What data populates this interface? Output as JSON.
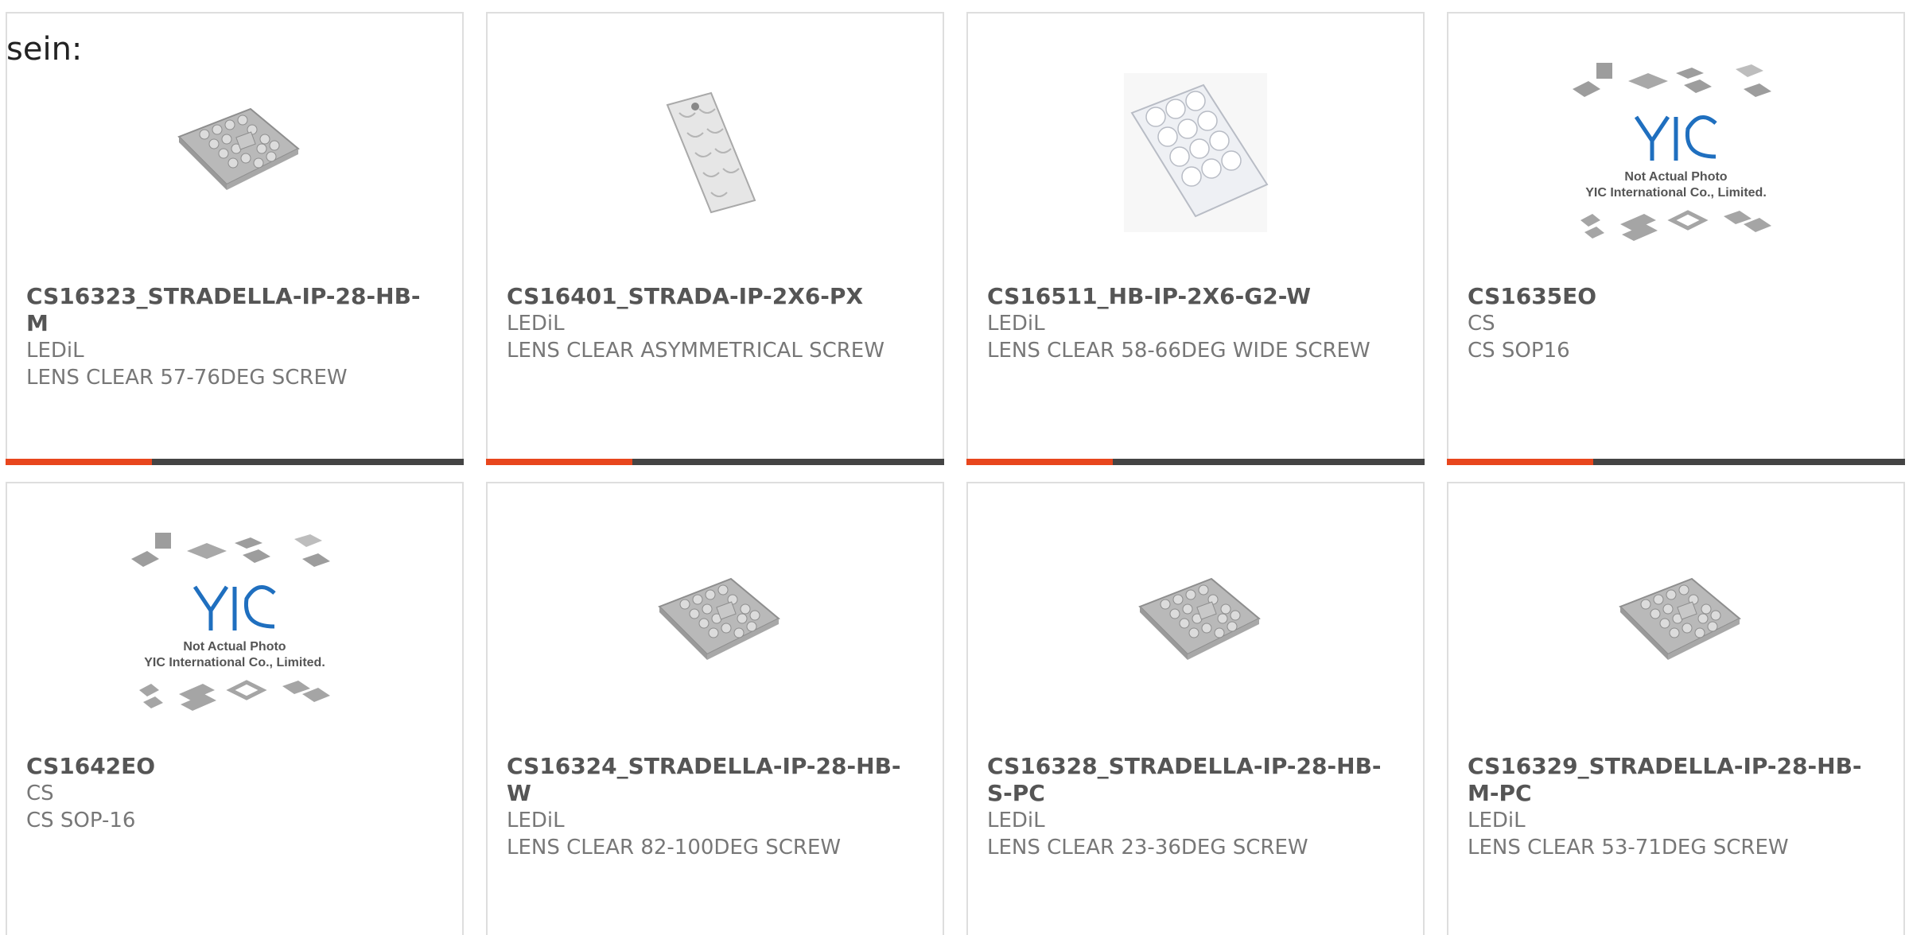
{
  "intro_text": "sein:",
  "colors": {
    "accent": "#e8461d",
    "bar": "#444444",
    "border": "#dedede"
  },
  "placeholder": {
    "logo": "YIC",
    "line1": "Not Actual Photo",
    "line2": "YIC International Co., Limited."
  },
  "products": [
    {
      "part": "CS16323_STRADELLA-IP-28-HB-M",
      "mfr": "LEDiL",
      "desc": "LENS CLEAR 57-76DEG SCREW",
      "image": "square-lens"
    },
    {
      "part": "CS16401_STRADA-IP-2X6-PX",
      "mfr": "LEDiL",
      "desc": "LENS CLEAR ASYMMETRICAL SCREW",
      "image": "narrow-lens"
    },
    {
      "part": "CS16511_HB-IP-2X6-G2-W",
      "mfr": "LEDiL",
      "desc": "LENS CLEAR 58-66DEG WIDE SCREW",
      "image": "wide-lens"
    },
    {
      "part": "CS1635EO",
      "mfr": "CS",
      "desc": "CS SOP16",
      "image": "placeholder"
    },
    {
      "part": "CS1642EO",
      "mfr": "CS",
      "desc": "CS SOP-16",
      "image": "placeholder"
    },
    {
      "part": "CS16324_STRADELLA-IP-28-HB-W",
      "mfr": "LEDiL",
      "desc": "LENS CLEAR 82-100DEG SCREW",
      "image": "square-lens"
    },
    {
      "part": "CS16328_STRADELLA-IP-28-HB-S-PC",
      "mfr": "LEDiL",
      "desc": "LENS CLEAR 23-36DEG SCREW",
      "image": "square-lens"
    },
    {
      "part": "CS16329_STRADELLA-IP-28-HB-M-PC",
      "mfr": "LEDiL",
      "desc": "LENS CLEAR 53-71DEG SCREW",
      "image": "square-lens"
    }
  ]
}
